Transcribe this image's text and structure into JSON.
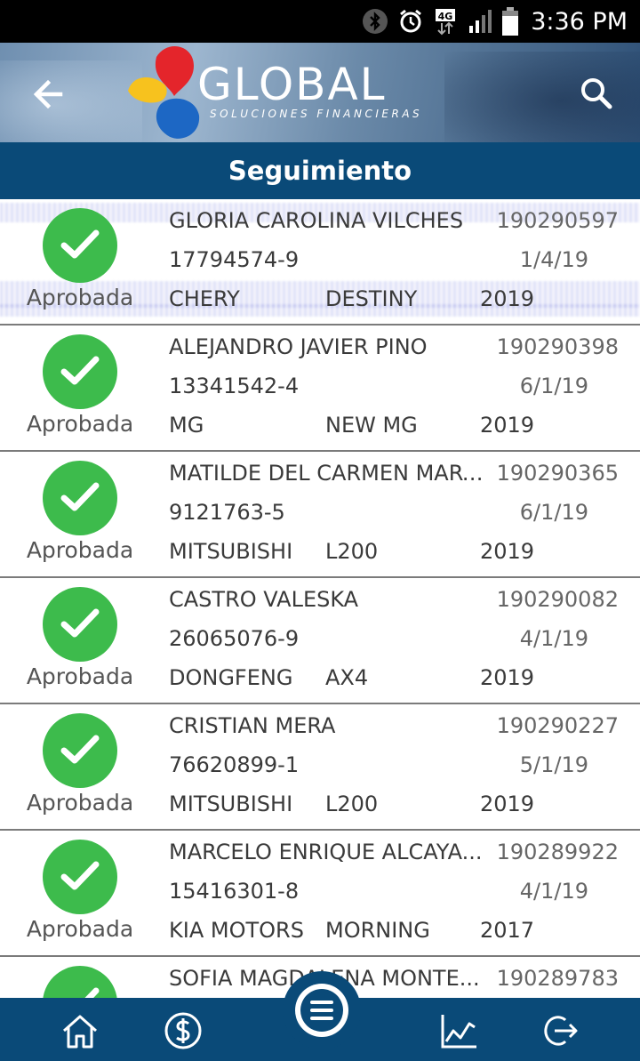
{
  "status_bar": {
    "time": "3:36 PM",
    "network": "4G",
    "icons": [
      "bluetooth-icon",
      "alarm-icon",
      "network-4g-icon",
      "signal-icon",
      "battery-icon"
    ]
  },
  "header": {
    "logo_text": "GLOBAL",
    "logo_subtitle": "SOLUCIONES FINANCIERAS",
    "back_icon": "arrow-back-icon",
    "search_icon": "search-icon"
  },
  "page": {
    "title": "Seguimiento"
  },
  "colors": {
    "primary": "#0a4a78",
    "approved_green": "#3dbb4c",
    "text": "#3a3a3a"
  },
  "requests": [
    {
      "status": "Aprobada",
      "name": "GLORIA CAROLINA VILCHES",
      "number": "190290597",
      "rut": "17794574-9",
      "date": "1/4/19",
      "brand": "CHERY",
      "model": "DESTINY",
      "year": "2019"
    },
    {
      "status": "Aprobada",
      "name": "ALEJANDRO JAVIER PINO",
      "number": "190290398",
      "rut": "13341542-4",
      "date": "6/1/19",
      "brand": "MG",
      "model": "NEW MG",
      "year": "2019"
    },
    {
      "status": "Aprobada",
      "name": "MATILDE DEL CARMEN MART...",
      "number": "190290365",
      "rut": "9121763-5",
      "date": "6/1/19",
      "brand": "MITSUBISHI",
      "model": "L200",
      "year": "2019"
    },
    {
      "status": "Aprobada",
      "name": "CASTRO VALESKA",
      "number": "190290082",
      "rut": "26065076-9",
      "date": "4/1/19",
      "brand": "DONGFENG",
      "model": "AX4",
      "year": "2019"
    },
    {
      "status": "Aprobada",
      "name": "CRISTIAN MERA",
      "number": "190290227",
      "rut": "76620899-1",
      "date": "5/1/19",
      "brand": "MITSUBISHI",
      "model": "L200",
      "year": "2019"
    },
    {
      "status": "Aprobada",
      "name": "MARCELO ENRIQUE ALCAYA...",
      "number": "190289922",
      "rut": "15416301-8",
      "date": "4/1/19",
      "brand": "KIA MOTORS",
      "model": "MORNING",
      "year": "2017"
    },
    {
      "status": "Aprobada",
      "name": "SOFIA MAGDALENA MONTE...",
      "number": "190289783",
      "rut": "",
      "date": "",
      "brand": "",
      "model": "",
      "year": ""
    }
  ],
  "bottom_nav": {
    "items": [
      "home-icon",
      "dollar-icon",
      "menu-icon",
      "chart-icon",
      "logout-icon"
    ]
  }
}
